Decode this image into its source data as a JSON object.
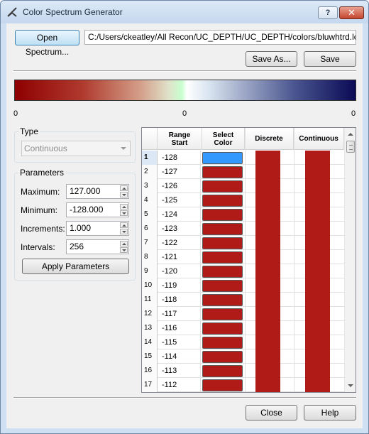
{
  "window": {
    "title": "Color Spectrum Generator"
  },
  "titlebar": {
    "help_label": "?",
    "close_label": "✕"
  },
  "toolbar": {
    "open_label": "Open Spectrum...",
    "path_value": "C:/Users/ckeatley/All Recon/UC_DEPTH/UC_DEPTH/colors/bluwhtrd.lcs",
    "save_as_label": "Save As...",
    "save_label": "Save"
  },
  "spectrum": {
    "ticks": [
      "0",
      "0",
      "0"
    ],
    "colors": {
      "start": "#8e0000",
      "middle": "#ffffff",
      "end": "#0b0a55"
    }
  },
  "type_group": {
    "title": "Type",
    "selected": "Continuous"
  },
  "params_group": {
    "title": "Parameters",
    "maximum_label": "Maximum:",
    "maximum_value": "127.000",
    "minimum_label": "Minimum:",
    "minimum_value": "-128.000",
    "increments_label": "Increments:",
    "increments_value": "1.000",
    "intervals_label": "Intervals:",
    "intervals_value": "256",
    "apply_label": "Apply Parameters"
  },
  "table": {
    "headers": {
      "range_start": "Range\nStart",
      "select_color": "Select\nColor",
      "discrete": "Discrete",
      "continuous": "Continuous"
    },
    "selected_color": "#3399ff",
    "rows": [
      {
        "num": "1",
        "start": "-128",
        "color": "#b01a17"
      },
      {
        "num": "2",
        "start": "-127",
        "color": "#b01a17"
      },
      {
        "num": "3",
        "start": "-126",
        "color": "#b01a17"
      },
      {
        "num": "4",
        "start": "-125",
        "color": "#b01a17"
      },
      {
        "num": "5",
        "start": "-124",
        "color": "#b01a17"
      },
      {
        "num": "6",
        "start": "-123",
        "color": "#b01a17"
      },
      {
        "num": "7",
        "start": "-122",
        "color": "#b01a17"
      },
      {
        "num": "8",
        "start": "-121",
        "color": "#b01a17"
      },
      {
        "num": "9",
        "start": "-120",
        "color": "#b01a17"
      },
      {
        "num": "10",
        "start": "-119",
        "color": "#b01a17"
      },
      {
        "num": "11",
        "start": "-118",
        "color": "#b01a17"
      },
      {
        "num": "12",
        "start": "-117",
        "color": "#b01a17"
      },
      {
        "num": "13",
        "start": "-116",
        "color": "#b01a17"
      },
      {
        "num": "14",
        "start": "-115",
        "color": "#b01a17"
      },
      {
        "num": "15",
        "start": "-114",
        "color": "#b01a17"
      },
      {
        "num": "16",
        "start": "-113",
        "color": "#b01a17"
      },
      {
        "num": "17",
        "start": "-112",
        "color": "#b01a17"
      }
    ]
  },
  "footer": {
    "close_label": "Close",
    "help_label": "Help"
  }
}
